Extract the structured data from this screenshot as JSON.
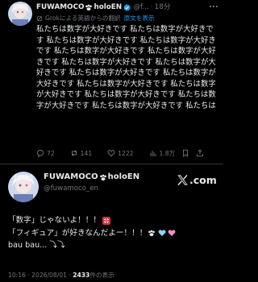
{
  "post1": {
    "display_name": "FUWAMOCO",
    "name_suffix": "holoEN",
    "handle": "@f...",
    "separator": "·",
    "time": "18分",
    "translation_note": "Grokによる英語からの翻訳",
    "show_original": "原文を表示",
    "body": "私たちは数字が大好きです 私たちは数字が大好きです 私たちは数字が大好きです 私たちは数字が大好きです 私たちは数字が大好きです 私たちは数字が大好きです 私たちは数字が大好きです 私たちは数字が大好きです 私たちは数字が大好きです 私たちは数字が大好きです 私たちは数字が大好きです 私たちは数字が大好きです 私たちは数字が大好きです 私たちは数字が大好きです 私たちは数字が大好きです 私たちは",
    "replies": "72",
    "reposts": "141",
    "likes": "1222",
    "views": "1.8万"
  },
  "post2": {
    "display_name": "FUWAMOCO",
    "name_suffix": "holoEN",
    "handle": "@fuwamoco_en",
    "x_brand": ".com",
    "line1": "「数字」じゃないよ！！！",
    "line2": "「フィギュア」が好きなんだよー！！！",
    "line3": "bau bau... ⤵⤵",
    "time": "10:16",
    "separator": "·",
    "date": "2026/08/01",
    "view_count": "2433",
    "view_label": "件の表示"
  },
  "colors": {
    "background": "#000000",
    "text": "#e7e9ea",
    "muted": "#71767b",
    "link": "#1d9bf0",
    "verified": "#1d9bf0",
    "divider": "#2f3336"
  },
  "icons": [
    "avatar",
    "paw-icon",
    "verified-badge-icon",
    "more-icon",
    "grok-icon",
    "reply-icon",
    "repost-icon",
    "like-icon",
    "views-icon",
    "bookmark-icon",
    "share-icon",
    "x-logo-icon",
    "anger-icon",
    "heart-blue-icon",
    "heart-pink-icon"
  ]
}
